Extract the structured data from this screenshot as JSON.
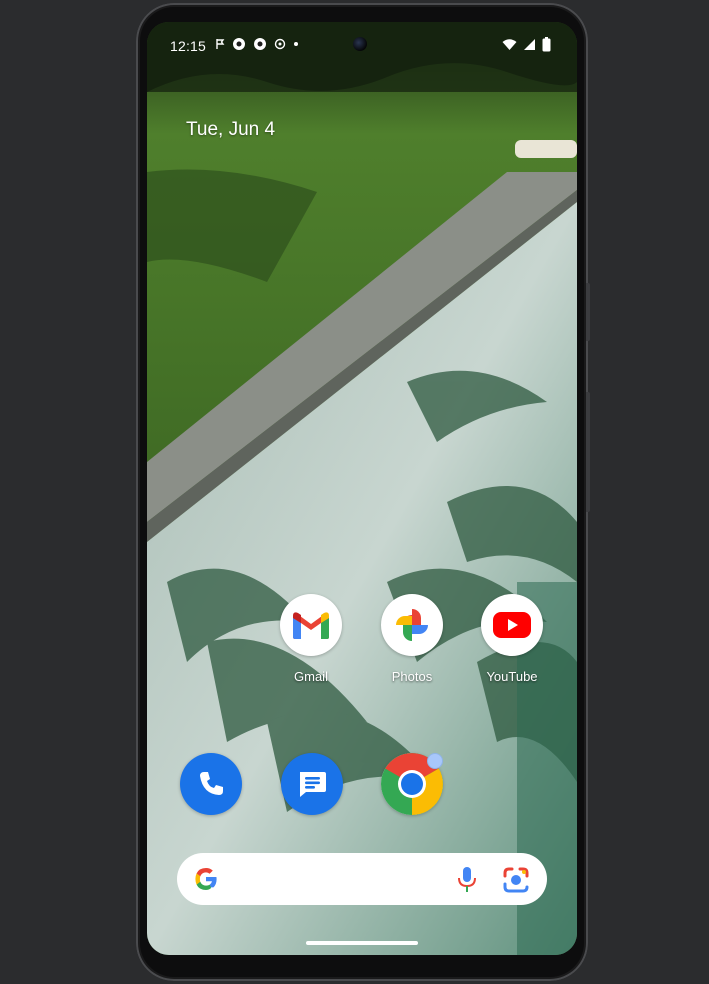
{
  "status_bar": {
    "time": "12:15",
    "left_icons": [
      "notification-flag-icon",
      "chrome-notification-icon",
      "chrome-notification-icon",
      "notification-icon",
      "more-notifications-dot-icon"
    ],
    "right_icons": [
      "wifi-icon",
      "cellular-signal-icon",
      "battery-icon"
    ]
  },
  "home": {
    "date": "Tue, Jun 4"
  },
  "apps": [
    {
      "label": "Gmail",
      "icon": "gmail-icon"
    },
    {
      "label": "Photos",
      "icon": "photos-icon"
    },
    {
      "label": "YouTube",
      "icon": "youtube-icon"
    }
  ],
  "dock": [
    {
      "icon": "phone-icon",
      "color": "#1a73e8"
    },
    {
      "icon": "messages-icon",
      "color": "#1a73e8"
    },
    {
      "icon": "chrome-icon",
      "badge": true
    }
  ],
  "search": {
    "logo": "google-g-icon",
    "mic_icon": "mic-icon",
    "lens_icon": "lens-icon"
  },
  "colors": {
    "dock_blue": "#1a73e8",
    "google_blue": "#4285f4",
    "google_red": "#ea4335",
    "google_yellow": "#fbbc04",
    "google_green": "#34a853",
    "youtube_red": "#ff0000"
  }
}
